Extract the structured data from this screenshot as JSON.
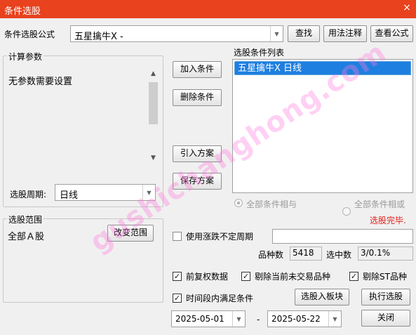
{
  "window": {
    "title": "条件选股",
    "close_glyph": "×"
  },
  "formula": {
    "label": "条件选股公式",
    "selected": "五星擒牛X  -",
    "find_button": "查找",
    "usage_button": "用法注释",
    "view_button": "查看公式"
  },
  "params": {
    "legend": "计算参数",
    "message": "无参数需要设置",
    "period_label": "选股周期:",
    "period_value": "日线"
  },
  "actions": {
    "add_condition": "加入条件",
    "delete_condition": "删除条件",
    "import_plan": "引入方案",
    "save_plan": "保存方案"
  },
  "condition_list": {
    "legend": "选股条件列表",
    "items": [
      "五星擒牛X  日线"
    ]
  },
  "logic": {
    "and_label": "全部条件相与",
    "or_label": "全部条件相或"
  },
  "status": {
    "text": "选股完毕.",
    "color": "#e0201b"
  },
  "scope": {
    "legend": "选股范围",
    "value": "全部Ａ股",
    "change_button": "改变范围"
  },
  "stats": {
    "use_cycle_label": "使用涨跌不定周期",
    "count_label": "品种数",
    "count_value": "5418",
    "selected_label": "选中数",
    "selected_value": "3/0.1%"
  },
  "options": {
    "pre_adjust": "前复权数据",
    "exclude_untraded": "剔除当前未交易品种",
    "exclude_st": "剔除ST品种",
    "period_satisfy": "时间段内满足条件"
  },
  "dates": {
    "start": "2025-05-01",
    "separator": "-",
    "end": "2025-05-22"
  },
  "bottom_buttons": {
    "to_block": "选股入板块",
    "execute": "执行选股",
    "close": "关闭"
  },
  "watermark": "gushichanghong.com",
  "colors": {
    "titlebar": "#e8421e",
    "selection": "#1e7fe0",
    "status": "#e0201b"
  }
}
